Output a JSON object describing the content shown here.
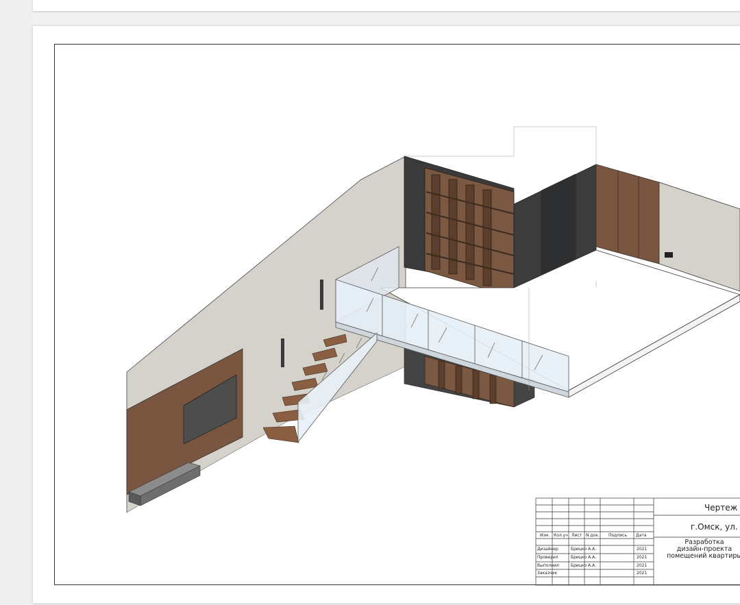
{
  "title_block": {
    "header": {
      "izm": "Изм.",
      "kol": "Кол.уч",
      "list": "Лист",
      "ndok": "N док.",
      "podpis": "Подпись",
      "data": "Дата"
    },
    "rows": [
      {
        "role": "Дизайнер",
        "name": "Брицко А.А.",
        "year": "2021"
      },
      {
        "role": "Проверил",
        "name": "Брицко А.А.",
        "year": "2021"
      },
      {
        "role": "Выполнил",
        "name": "Брицко А.А.",
        "year": "2021"
      },
      {
        "role": "Заказчик",
        "name": "",
        "year": "2021"
      }
    ],
    "drawing_title": "Чертеж",
    "address": "г.Омск, ул. Ш",
    "project_line1": "Разработка",
    "project_line2": "дизайн-проекта",
    "project_line3": "помещений квартиры"
  }
}
